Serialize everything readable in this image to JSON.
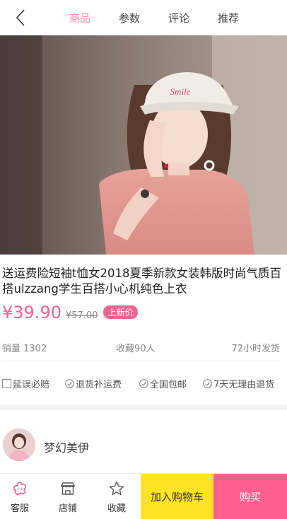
{
  "header": {
    "tabs": [
      {
        "label": "商品",
        "active": true
      },
      {
        "label": "参数",
        "active": false
      },
      {
        "label": "评论",
        "active": false
      },
      {
        "label": "推荐",
        "active": false
      }
    ]
  },
  "product": {
    "title": "送运费险短袖t恤女2018夏季新款女装韩版时尚气质百搭ulzzang学生百搭小心机纯色上衣",
    "price": "¥39.90",
    "old_price": "¥57.00",
    "badge": "上新价",
    "hat_text": "Smile",
    "sales": "销量 1302",
    "favorites": "收藏90人",
    "shipping": "72小时发货",
    "guarantees": [
      "延误必赔",
      "退货补运费",
      "全国包邮",
      "7天无理由退货"
    ]
  },
  "shop": {
    "name": "梦幻美伊"
  },
  "bottom_bar": {
    "service_label": "客服",
    "store_label": "店铺",
    "collect_label": "收藏",
    "cart_label": "加入购物车",
    "buy_label": "购买"
  },
  "colors": {
    "accent_pink": "#f06292",
    "cart_yellow": "#ffe324",
    "buy_pink": "#ff5f8d"
  },
  "icons": {
    "back": "chevron-left-icon",
    "service": "flower-chat-icon",
    "store": "storefront-icon",
    "collect": "star-outline-icon",
    "check": "check-circle-icon"
  }
}
